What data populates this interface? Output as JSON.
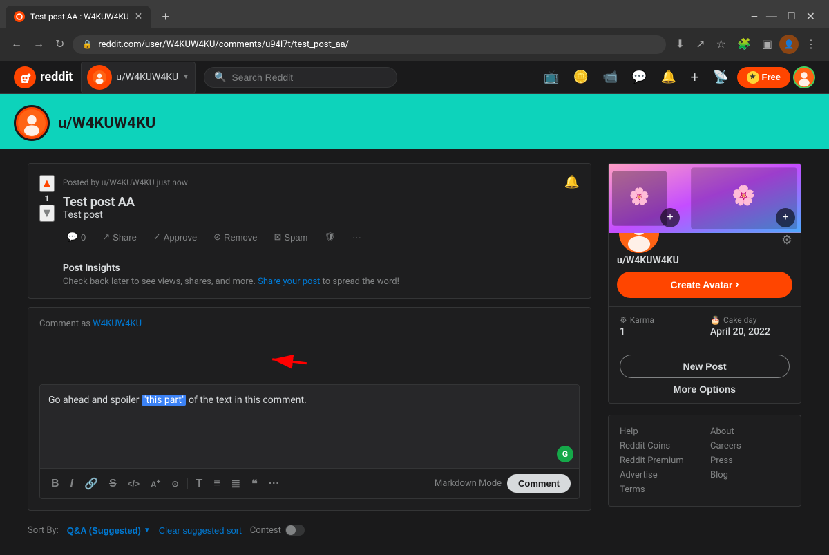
{
  "browser": {
    "tab_title": "Test post AA : W4KUW4KU",
    "new_tab_icon": "+",
    "address": "reddit.com/user/W4KUW4KU/comments/u94l7t/test_post_aa/",
    "window_controls": {
      "minimize": "—",
      "maximize": "□",
      "close": "✕"
    }
  },
  "header": {
    "logo_text": "reddit",
    "user_badge": "u/W4KUW4KU",
    "search_placeholder": "Search Reddit",
    "free_btn_label": "Free",
    "add_icon": "+",
    "chevron": "▼"
  },
  "profile_banner": {
    "username": "u/W4KUW4KU"
  },
  "post": {
    "meta": "Posted by u/W4KUW4KU just now",
    "vote_count": "1",
    "title": "Test post AA",
    "body": "Test post",
    "actions": {
      "comment_label": "0",
      "share_label": "Share",
      "approve_label": "Approve",
      "remove_label": "Remove",
      "spam_label": "Spam",
      "more_label": "···"
    },
    "insights": {
      "title": "Post Insights",
      "text": "Check back later to see views, shares, and more.",
      "link_text": "Share your post",
      "link_suffix": " to spread the word!"
    }
  },
  "comment": {
    "as_label": "Comment as",
    "as_user": "W4KUW4KU",
    "text_before": "Go ahead and spoiler ",
    "text_highlighted": "\"this part\"",
    "text_after": " of the text in this comment.",
    "grammarly": "G",
    "toolbar": {
      "bold": "B",
      "italic": "I",
      "link": "🔗",
      "strikethrough": "S",
      "code_inline": "</>",
      "superscript": "A",
      "spoiler": "⊙",
      "text_size": "T",
      "bullets": "≡",
      "numbered": "≣",
      "quote": "❝",
      "more": "···",
      "mode_label": "Markdown Mode",
      "submit_label": "Comment"
    }
  },
  "sort": {
    "label": "Sort By:",
    "active": "Q&A (Suggested)",
    "chevron": "▼",
    "clear_label": "Clear suggested sort",
    "contest_label": "Contest"
  },
  "sidebar": {
    "username": "u/W4KUW4KU",
    "create_avatar_label": "Create Avatar",
    "karma_label": "Karma",
    "karma_value": "1",
    "cake_day_label": "Cake day",
    "cake_day_value": "April 20, 2022",
    "new_post_label": "New Post",
    "more_options_label": "More Options",
    "links": [
      "Help",
      "About",
      "Reddit Coins",
      "Careers",
      "Reddit Premium",
      "Press",
      "",
      "Advertise",
      "",
      "Blog",
      "",
      "Terms"
    ]
  },
  "colors": {
    "upvote": "#ff4500",
    "downvote": "#818384",
    "reddit_orange": "#ff4500",
    "blue": "#0079d3",
    "green_badge": "#46d160",
    "teal_banner": "#0dd3bb"
  }
}
